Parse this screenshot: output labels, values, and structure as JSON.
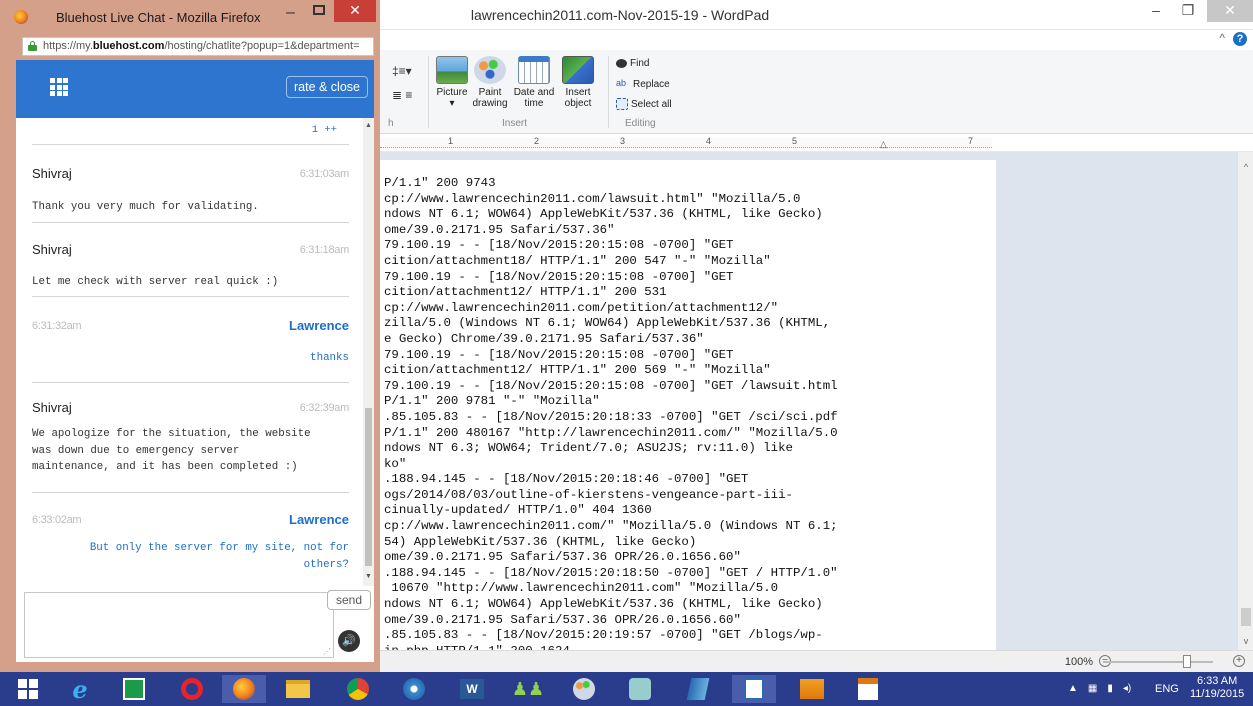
{
  "wordpad": {
    "title": "lawrencechin2011.com-Nov-2015-19 - WordPad",
    "ribbon": {
      "picture_label": "Picture",
      "paint_label": "Paint\ndrawing",
      "datetime_label": "Date and\ntime",
      "insert_object_label": "Insert\nobject",
      "group_insert": "Insert",
      "find_label": "Find",
      "replace_label": "Replace",
      "select_all_label": "Select all",
      "group_editing": "Editing"
    },
    "ruler_numbers": [
      "1",
      "2",
      "3",
      "4",
      "5",
      "7"
    ],
    "doc_lines": [
      "P/1.1\" 200 9743",
      "cp://www.lawrencechin2011.com/lawsuit.html\" \"Mozilla/5.0",
      "ndows NT 6.1; WOW64) AppleWebKit/537.36 (KHTML, like Gecko)",
      "ome/39.0.2171.95 Safari/537.36\"",
      "79.100.19 - - [18/Nov/2015:20:15:08 -0700] \"GET",
      "cition/attachment18/ HTTP/1.1\" 200 547 \"-\" \"Mozilla\"",
      "79.100.19 - - [18/Nov/2015:20:15:08 -0700] \"GET",
      "cition/attachment12/ HTTP/1.1\" 200 531",
      "cp://www.lawrencechin2011.com/petition/attachment12/\"",
      "zilla/5.0 (Windows NT 6.1; WOW64) AppleWebKit/537.36 (KHTML,",
      "e Gecko) Chrome/39.0.2171.95 Safari/537.36\"",
      "79.100.19 - - [18/Nov/2015:20:15:08 -0700] \"GET",
      "cition/attachment12/ HTTP/1.1\" 200 569 \"-\" \"Mozilla\"",
      "79.100.19 - - [18/Nov/2015:20:15:08 -0700] \"GET /lawsuit.html",
      "P/1.1\" 200 9781 \"-\" \"Mozilla\"",
      ".85.105.83 - - [18/Nov/2015:20:18:33 -0700] \"GET /sci/sci.pdf",
      "P/1.1\" 200 480167 \"http://lawrencechin2011.com/\" \"Mozilla/5.0",
      "ndows NT 6.3; WOW64; Trident/7.0; ASU2JS; rv:11.0) like",
      "ko\"",
      ".188.94.145 - - [18/Nov/2015:20:18:46 -0700] \"GET",
      "ogs/2014/08/03/outline-of-kierstens-vengeance-part-iii-",
      "cinually-updated/ HTTP/1.0\" 404 1360",
      "cp://www.lawrencechin2011.com/\" \"Mozilla/5.0 (Windows NT 6.1;",
      "54) AppleWebKit/537.36 (KHTML, like Gecko)",
      "ome/39.0.2171.95 Safari/537.36 OPR/26.0.1656.60\"",
      ".188.94.145 - - [18/Nov/2015:20:18:50 -0700] \"GET / HTTP/1.0\"",
      " 10670 \"http://www.lawrencechin2011.com\" \"Mozilla/5.0",
      "ndows NT 6.1; WOW64) AppleWebKit/537.36 (KHTML, like Gecko)",
      "ome/39.0.2171.95 Safari/537.36 OPR/26.0.1656.60\"",
      ".85.105.83 - - [18/Nov/2015:20:19:57 -0700] \"GET /blogs/wp-",
      "in.php HTTP/1.1\" 200 1624"
    ],
    "zoom_label": "100%"
  },
  "firefox": {
    "title": "Bluehost Live Chat - Mozilla Firefox",
    "url_prefix": "https://my.",
    "url_domain": "bluehost.com",
    "url_rest": "/hosting/chatlite?popup=1&department="
  },
  "chat": {
    "rate_close_label": "rate & close",
    "top_note": "1 ++",
    "messages": [
      {
        "sender": "Shivraj",
        "time": "6:31:03am",
        "text": "Thank you very much for validating."
      },
      {
        "sender": "Shivraj",
        "time": "6:31:18am",
        "text": "Let me check with server real quick :)"
      },
      {
        "sender": "Lawrence",
        "time": "6:31:32am",
        "text": "thanks"
      },
      {
        "sender": "Shivraj",
        "time": "6:32:39am",
        "text": "We apologize for the situation, the website was down due to emergency server maintenance, and it has been completed :)"
      },
      {
        "sender": "Lawrence",
        "time": "6:33:02am",
        "text": "But only the server for my site, not for others?"
      }
    ],
    "send_label": "send"
  },
  "taskbar": {
    "lang": "ENG",
    "time": "6:33 AM",
    "date": "11/19/2015"
  }
}
